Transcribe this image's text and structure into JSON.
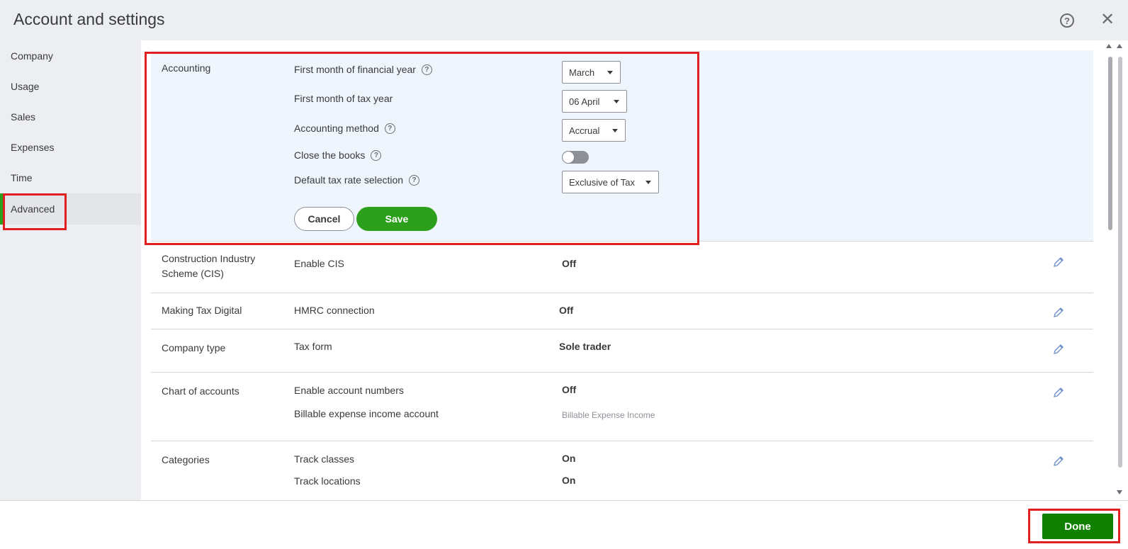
{
  "header": {
    "title": "Account and settings",
    "help_icon": "?",
    "close_icon": "✕"
  },
  "sidebar": {
    "items": [
      {
        "label": "Company"
      },
      {
        "label": "Usage"
      },
      {
        "label": "Sales"
      },
      {
        "label": "Expenses"
      },
      {
        "label": "Time"
      },
      {
        "label": "Advanced",
        "active": true
      }
    ]
  },
  "accounting": {
    "title": "Accounting",
    "first_month_fy_label": "First month of financial year",
    "first_month_fy_value": "March",
    "first_month_tax_label": "First month of tax year",
    "first_month_tax_value": "06 April",
    "method_label": "Accounting method",
    "method_value": "Accrual",
    "close_books_label": "Close the books",
    "close_books_on": false,
    "default_tax_label": "Default tax rate selection",
    "default_tax_value": "Exclusive of Tax",
    "cancel_label": "Cancel",
    "save_label": "Save",
    "help_glyph": "?"
  },
  "cis": {
    "title": "Construction Industry Scheme (CIS)",
    "label": "Enable CIS",
    "value": "Off"
  },
  "mtd": {
    "title": "Making Tax Digital",
    "label": "HMRC connection",
    "value": "Off"
  },
  "company_type": {
    "title": "Company type",
    "label": "Tax form",
    "value": "Sole trader"
  },
  "chart_of_accounts": {
    "title": "Chart of accounts",
    "label1": "Enable account numbers",
    "value1": "Off",
    "label2": "Billable expense income account",
    "value2": "Billable Expense Income"
  },
  "categories": {
    "title": "Categories",
    "label1": "Track classes",
    "value1": "On",
    "label2": "Track locations",
    "value2": "On"
  },
  "footer": {
    "done_label": "Done"
  },
  "colors": {
    "accent_green": "#2ca01c",
    "done_green": "#108000",
    "annotation_red": "#e02020",
    "edit_bg": "#eff5fd",
    "pencil_blue": "#6b8fc9"
  }
}
